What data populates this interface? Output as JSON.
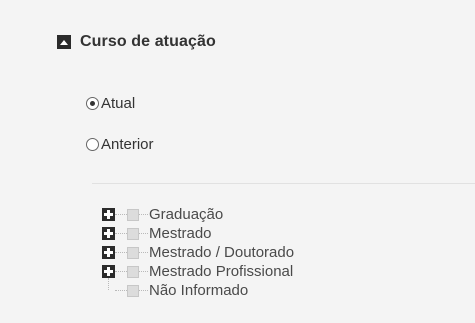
{
  "section": {
    "title": "Curso de atuação",
    "collapse_icon": "minus-square-icon"
  },
  "radio": {
    "options": [
      {
        "label": "Atual",
        "checked": true
      },
      {
        "label": "Anterior",
        "checked": false
      }
    ]
  },
  "tree": {
    "items": [
      {
        "label": "Graduação",
        "expandable": true
      },
      {
        "label": "Mestrado",
        "expandable": true
      },
      {
        "label": "Mestrado / Doutorado",
        "expandable": true
      },
      {
        "label": "Mestrado Profissional",
        "expandable": true
      },
      {
        "label": "Não Informado",
        "expandable": false
      }
    ],
    "expand_icon": "plus-square-icon"
  },
  "colors": {
    "panel_bg": "#f4f4f4",
    "icon_dark": "#2b2b2b",
    "checkbox_fill": "#dcdcdc"
  }
}
